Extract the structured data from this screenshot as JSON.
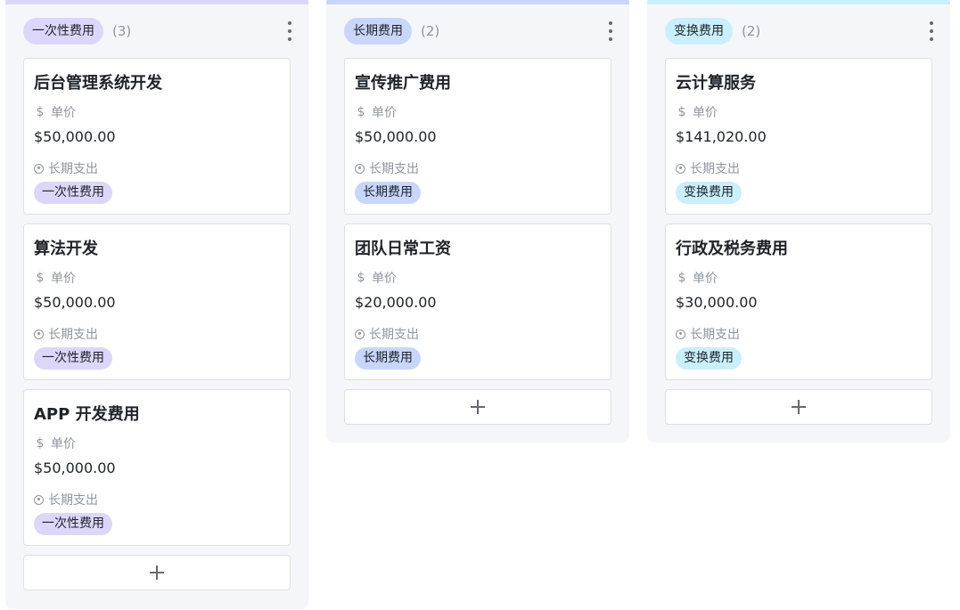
{
  "colors": {
    "one_time": "#ddd6fb",
    "long_term": "#c9d6fb",
    "exchange": "#caeffc"
  },
  "columns": [
    {
      "tag": "一次性费用",
      "count": "(3)",
      "color": "#ddd6fb",
      "cards": [
        {
          "title": "后台管理系统开发",
          "price_label": "单价",
          "price": "$50,000.00",
          "type_label": "长期支出",
          "tag": "一次性费用"
        },
        {
          "title": "算法开发",
          "price_label": "单价",
          "price": "$50,000.00",
          "type_label": "长期支出",
          "tag": "一次性费用"
        },
        {
          "title": "APP 开发费用",
          "price_label": "单价",
          "price": "$50,000.00",
          "type_label": "长期支出",
          "tag": "一次性费用"
        }
      ]
    },
    {
      "tag": "长期费用",
      "count": "(2)",
      "color": "#c9d6fb",
      "cards": [
        {
          "title": "宣传推广费用",
          "price_label": "单价",
          "price": "$50,000.00",
          "type_label": "长期支出",
          "tag": "长期费用"
        },
        {
          "title": "团队日常工资",
          "price_label": "单价",
          "price": "$20,000.00",
          "type_label": "长期支出",
          "tag": "长期费用"
        }
      ]
    },
    {
      "tag": "变换费用",
      "count": "(2)",
      "color": "#caeffc",
      "cards": [
        {
          "title": "云计算服务",
          "price_label": "单价",
          "price": "$141,020.00",
          "type_label": "长期支出",
          "tag": "变换费用"
        },
        {
          "title": "行政及税务费用",
          "price_label": "单价",
          "price": "$30,000.00",
          "type_label": "长期支出",
          "tag": "变换费用"
        }
      ]
    }
  ],
  "icons": {
    "price": "dollar-icon",
    "type": "circle-dot-icon",
    "more": "more-vertical-icon",
    "add": "plus-icon"
  }
}
